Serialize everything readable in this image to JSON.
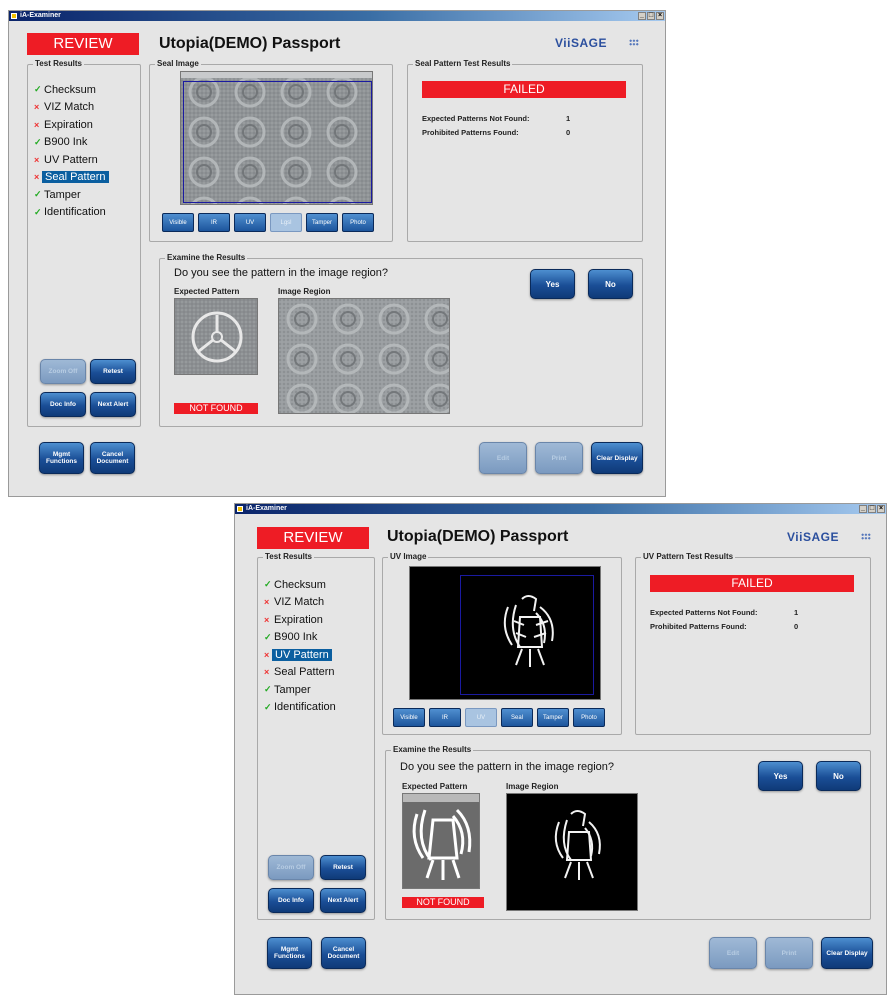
{
  "windows": [
    {
      "app_title": "iA-Examiner",
      "window_buttons": [
        "_",
        "□",
        "×"
      ],
      "status": "REVIEW",
      "document_title": "Utopia(DEMO) Passport",
      "logo": "ViiSAGE",
      "test_results": {
        "label": "Test Results",
        "items": [
          {
            "label": "Checksum",
            "mark": "✓",
            "state": "pass",
            "selected": false
          },
          {
            "label": "VIZ Match",
            "mark": "×",
            "state": "fail",
            "selected": false
          },
          {
            "label": "Expiration",
            "mark": "×",
            "state": "fail",
            "selected": false
          },
          {
            "label": "B900 Ink",
            "mark": "✓",
            "state": "pass",
            "selected": false
          },
          {
            "label": "UV Pattern",
            "mark": "×",
            "state": "fail",
            "selected": false
          },
          {
            "label": "Seal Pattern",
            "mark": "×",
            "state": "fail",
            "selected": true
          },
          {
            "label": "Tamper",
            "mark": "✓",
            "state": "pass",
            "selected": false
          },
          {
            "label": "Identification",
            "mark": "✓",
            "state": "pass",
            "selected": false
          }
        ]
      },
      "image_panel": {
        "label": "Seal Image",
        "buttons": [
          {
            "label": "Visible",
            "active": false
          },
          {
            "label": "IR",
            "active": false
          },
          {
            "label": "UV",
            "active": false
          },
          {
            "label": "Lgsl",
            "active": true
          },
          {
            "label": "Tamper",
            "active": false
          },
          {
            "label": "Photo",
            "active": false
          }
        ]
      },
      "results_panel": {
        "label": "Seal Pattern Test Results",
        "result": "FAILED",
        "stats": [
          {
            "label": "Expected Patterns Not Found:",
            "value": "1"
          },
          {
            "label": "Prohibited Patterns Found:",
            "value": "0"
          }
        ]
      },
      "examine": {
        "label": "Examine the Results",
        "question": "Do you see the pattern in the image region?",
        "yes": "Yes",
        "no": "No",
        "expected_label": "Expected Pattern",
        "region_label": "Image Region",
        "not_found": "NOT FOUND"
      },
      "side_buttons": [
        {
          "label": "Zoom Off",
          "enabled": false
        },
        {
          "label": "Retest",
          "enabled": true
        },
        {
          "label": "Doc Info",
          "enabled": true
        },
        {
          "label": "Next Alert",
          "enabled": true
        }
      ],
      "bottom_left_buttons": [
        {
          "label": "Mgmt Functions",
          "enabled": true
        },
        {
          "label": "Cancel Document",
          "enabled": true
        }
      ],
      "bottom_right_buttons": [
        {
          "label": "Edit",
          "enabled": false
        },
        {
          "label": "Print",
          "enabled": false
        },
        {
          "label": "Clear Display",
          "enabled": true
        }
      ],
      "viewer_style": "seal"
    },
    {
      "app_title": "iA-Examiner",
      "window_buttons": [
        "_",
        "□",
        "×"
      ],
      "status": "REVIEW",
      "document_title": "Utopia(DEMO) Passport",
      "logo": "ViiSAGE",
      "test_results": {
        "label": "Test Results",
        "items": [
          {
            "label": "Checksum",
            "mark": "✓",
            "state": "pass",
            "selected": false
          },
          {
            "label": "VIZ Match",
            "mark": "×",
            "state": "fail",
            "selected": false
          },
          {
            "label": "Expiration",
            "mark": "×",
            "state": "fail",
            "selected": false
          },
          {
            "label": "B900 Ink",
            "mark": "✓",
            "state": "pass",
            "selected": false
          },
          {
            "label": "UV Pattern",
            "mark": "×",
            "state": "fail",
            "selected": true
          },
          {
            "label": "Seal Pattern",
            "mark": "×",
            "state": "fail",
            "selected": false
          },
          {
            "label": "Tamper",
            "mark": "✓",
            "state": "pass",
            "selected": false
          },
          {
            "label": "Identification",
            "mark": "✓",
            "state": "pass",
            "selected": false
          }
        ]
      },
      "image_panel": {
        "label": "UV Image",
        "buttons": [
          {
            "label": "Visible",
            "active": false
          },
          {
            "label": "IR",
            "active": false
          },
          {
            "label": "UV",
            "active": true
          },
          {
            "label": "Seal",
            "active": false
          },
          {
            "label": "Tamper",
            "active": false
          },
          {
            "label": "Photo",
            "active": false
          }
        ]
      },
      "results_panel": {
        "label": "UV Pattern Test Results",
        "result": "FAILED",
        "stats": [
          {
            "label": "Expected Patterns Not Found:",
            "value": "1"
          },
          {
            "label": "Prohibited Patterns Found:",
            "value": "0"
          }
        ]
      },
      "examine": {
        "label": "Examine the Results",
        "question": "Do you see the pattern in the image region?",
        "yes": "Yes",
        "no": "No",
        "expected_label": "Expected Pattern",
        "region_label": "Image Region",
        "not_found": "NOT FOUND"
      },
      "side_buttons": [
        {
          "label": "Zoom Off",
          "enabled": false
        },
        {
          "label": "Retest",
          "enabled": true
        },
        {
          "label": "Doc Info",
          "enabled": true
        },
        {
          "label": "Next Alert",
          "enabled": true
        }
      ],
      "bottom_left_buttons": [
        {
          "label": "Mgmt Functions",
          "enabled": true
        },
        {
          "label": "Cancel Document",
          "enabled": true
        }
      ],
      "bottom_right_buttons": [
        {
          "label": "Edit",
          "enabled": false
        },
        {
          "label": "Print",
          "enabled": false
        },
        {
          "label": "Clear Display",
          "enabled": true
        }
      ],
      "viewer_style": "uv"
    }
  ]
}
